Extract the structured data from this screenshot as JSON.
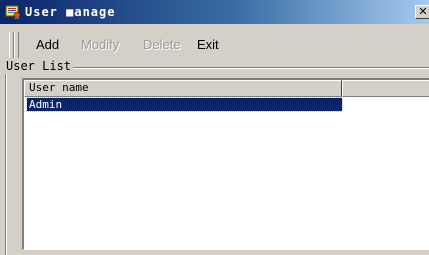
{
  "window": {
    "title": "User ■anage",
    "close_glyph": "✕",
    "icon": "user-manage-app-icon"
  },
  "toolbar": {
    "buttons": [
      {
        "label": "Add",
        "enabled": true
      },
      {
        "label": "Modify",
        "enabled": false
      },
      {
        "label": "Delete",
        "enabled": false
      },
      {
        "label": "Exit",
        "enabled": true
      }
    ]
  },
  "user_list": {
    "group_label": "User List",
    "columns": [
      "User name"
    ],
    "rows": [
      {
        "user_name": "Admin",
        "selected": true
      }
    ]
  },
  "colors": {
    "title_gradient_start": "#0a246a",
    "title_gradient_end": "#a6caf0",
    "selection": "#0a246a",
    "face": "#d4d0c8"
  }
}
